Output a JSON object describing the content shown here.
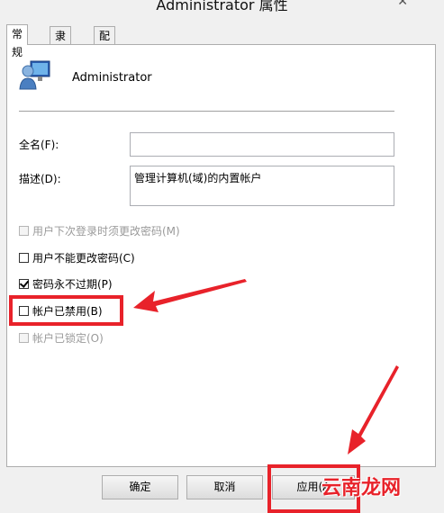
{
  "window": {
    "title": "Administrator 属性"
  },
  "tabs": [
    {
      "label": "常规",
      "active": true
    },
    {
      "label": "隶属于",
      "active": false
    },
    {
      "label": "配置文件",
      "active": false
    }
  ],
  "general": {
    "username": "Administrator",
    "fullname_label": "全名(F):",
    "fullname_value": "",
    "description_label": "描述(D):",
    "description_value": "管理计算机(域)的内置帐户"
  },
  "checkboxes": [
    {
      "label": "用户下次登录时须更改密码(M)",
      "checked": false,
      "enabled": false
    },
    {
      "label": "用户不能更改密码(C)",
      "checked": false,
      "enabled": true
    },
    {
      "label": "密码永不过期(P)",
      "checked": true,
      "enabled": true
    },
    {
      "label": "帐户已禁用(B)",
      "checked": false,
      "enabled": true
    },
    {
      "label": "帐户已锁定(O)",
      "checked": false,
      "enabled": false
    }
  ],
  "buttons": {
    "ok": "确定",
    "cancel": "取消",
    "apply": "应用(A"
  },
  "watermark": "云南龙网",
  "colors": {
    "annotation_red": "#e8222a"
  }
}
